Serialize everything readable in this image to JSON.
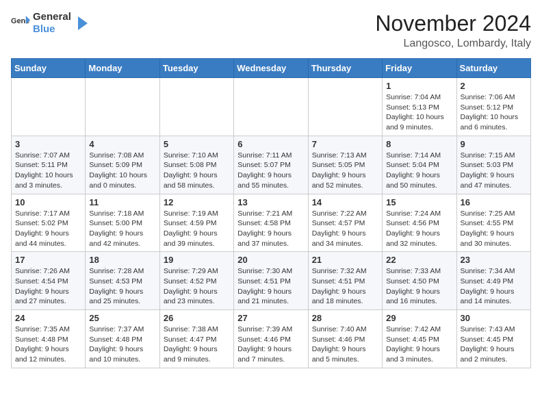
{
  "header": {
    "logo_general": "General",
    "logo_blue": "Blue",
    "month": "November 2024",
    "location": "Langosco, Lombardy, Italy"
  },
  "weekdays": [
    "Sunday",
    "Monday",
    "Tuesday",
    "Wednesday",
    "Thursday",
    "Friday",
    "Saturday"
  ],
  "weeks": [
    [
      {
        "day": "",
        "info": ""
      },
      {
        "day": "",
        "info": ""
      },
      {
        "day": "",
        "info": ""
      },
      {
        "day": "",
        "info": ""
      },
      {
        "day": "",
        "info": ""
      },
      {
        "day": "1",
        "info": "Sunrise: 7:04 AM\nSunset: 5:13 PM\nDaylight: 10 hours\nand 9 minutes."
      },
      {
        "day": "2",
        "info": "Sunrise: 7:06 AM\nSunset: 5:12 PM\nDaylight: 10 hours\nand 6 minutes."
      }
    ],
    [
      {
        "day": "3",
        "info": "Sunrise: 7:07 AM\nSunset: 5:11 PM\nDaylight: 10 hours\nand 3 minutes."
      },
      {
        "day": "4",
        "info": "Sunrise: 7:08 AM\nSunset: 5:09 PM\nDaylight: 10 hours\nand 0 minutes."
      },
      {
        "day": "5",
        "info": "Sunrise: 7:10 AM\nSunset: 5:08 PM\nDaylight: 9 hours\nand 58 minutes."
      },
      {
        "day": "6",
        "info": "Sunrise: 7:11 AM\nSunset: 5:07 PM\nDaylight: 9 hours\nand 55 minutes."
      },
      {
        "day": "7",
        "info": "Sunrise: 7:13 AM\nSunset: 5:05 PM\nDaylight: 9 hours\nand 52 minutes."
      },
      {
        "day": "8",
        "info": "Sunrise: 7:14 AM\nSunset: 5:04 PM\nDaylight: 9 hours\nand 50 minutes."
      },
      {
        "day": "9",
        "info": "Sunrise: 7:15 AM\nSunset: 5:03 PM\nDaylight: 9 hours\nand 47 minutes."
      }
    ],
    [
      {
        "day": "10",
        "info": "Sunrise: 7:17 AM\nSunset: 5:02 PM\nDaylight: 9 hours\nand 44 minutes."
      },
      {
        "day": "11",
        "info": "Sunrise: 7:18 AM\nSunset: 5:00 PM\nDaylight: 9 hours\nand 42 minutes."
      },
      {
        "day": "12",
        "info": "Sunrise: 7:19 AM\nSunset: 4:59 PM\nDaylight: 9 hours\nand 39 minutes."
      },
      {
        "day": "13",
        "info": "Sunrise: 7:21 AM\nSunset: 4:58 PM\nDaylight: 9 hours\nand 37 minutes."
      },
      {
        "day": "14",
        "info": "Sunrise: 7:22 AM\nSunset: 4:57 PM\nDaylight: 9 hours\nand 34 minutes."
      },
      {
        "day": "15",
        "info": "Sunrise: 7:24 AM\nSunset: 4:56 PM\nDaylight: 9 hours\nand 32 minutes."
      },
      {
        "day": "16",
        "info": "Sunrise: 7:25 AM\nSunset: 4:55 PM\nDaylight: 9 hours\nand 30 minutes."
      }
    ],
    [
      {
        "day": "17",
        "info": "Sunrise: 7:26 AM\nSunset: 4:54 PM\nDaylight: 9 hours\nand 27 minutes."
      },
      {
        "day": "18",
        "info": "Sunrise: 7:28 AM\nSunset: 4:53 PM\nDaylight: 9 hours\nand 25 minutes."
      },
      {
        "day": "19",
        "info": "Sunrise: 7:29 AM\nSunset: 4:52 PM\nDaylight: 9 hours\nand 23 minutes."
      },
      {
        "day": "20",
        "info": "Sunrise: 7:30 AM\nSunset: 4:51 PM\nDaylight: 9 hours\nand 21 minutes."
      },
      {
        "day": "21",
        "info": "Sunrise: 7:32 AM\nSunset: 4:51 PM\nDaylight: 9 hours\nand 18 minutes."
      },
      {
        "day": "22",
        "info": "Sunrise: 7:33 AM\nSunset: 4:50 PM\nDaylight: 9 hours\nand 16 minutes."
      },
      {
        "day": "23",
        "info": "Sunrise: 7:34 AM\nSunset: 4:49 PM\nDaylight: 9 hours\nand 14 minutes."
      }
    ],
    [
      {
        "day": "24",
        "info": "Sunrise: 7:35 AM\nSunset: 4:48 PM\nDaylight: 9 hours\nand 12 minutes."
      },
      {
        "day": "25",
        "info": "Sunrise: 7:37 AM\nSunset: 4:48 PM\nDaylight: 9 hours\nand 10 minutes."
      },
      {
        "day": "26",
        "info": "Sunrise: 7:38 AM\nSunset: 4:47 PM\nDaylight: 9 hours\nand 9 minutes."
      },
      {
        "day": "27",
        "info": "Sunrise: 7:39 AM\nSunset: 4:46 PM\nDaylight: 9 hours\nand 7 minutes."
      },
      {
        "day": "28",
        "info": "Sunrise: 7:40 AM\nSunset: 4:46 PM\nDaylight: 9 hours\nand 5 minutes."
      },
      {
        "day": "29",
        "info": "Sunrise: 7:42 AM\nSunset: 4:45 PM\nDaylight: 9 hours\nand 3 minutes."
      },
      {
        "day": "30",
        "info": "Sunrise: 7:43 AM\nSunset: 4:45 PM\nDaylight: 9 hours\nand 2 minutes."
      }
    ]
  ]
}
